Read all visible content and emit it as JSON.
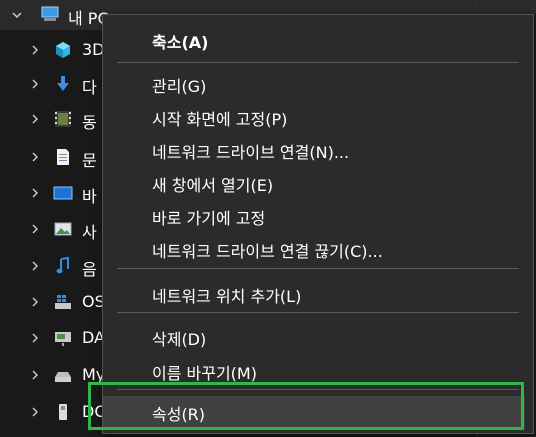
{
  "tree": {
    "root": {
      "label": "내 PC",
      "icon": "computer-icon"
    },
    "items": [
      {
        "label": "3D",
        "icon": "3d-objects-icon"
      },
      {
        "label": "다",
        "icon": "download-arrow-icon"
      },
      {
        "label": "동",
        "icon": "video-film-icon"
      },
      {
        "label": "문",
        "icon": "document-icon"
      },
      {
        "label": "바",
        "icon": "desktop-icon"
      },
      {
        "label": "사",
        "icon": "picture-icon"
      },
      {
        "label": "음",
        "icon": "music-note-icon"
      },
      {
        "label": "OS",
        "icon": "windows-drive-icon"
      },
      {
        "label": "DA",
        "icon": "network-drive-icon"
      },
      {
        "label": "My",
        "icon": "drive-icon"
      },
      {
        "label": "DC",
        "icon": "usb-drive-icon"
      }
    ]
  },
  "context_menu": {
    "items": [
      {
        "label": "축소(A)",
        "bold": true
      },
      {
        "separator": true
      },
      {
        "label": "관리(G)"
      },
      {
        "label": "시작 화면에 고정(P)"
      },
      {
        "label": "네트워크 드라이브 연결(N)..."
      },
      {
        "label": "새 창에서 열기(E)"
      },
      {
        "label": "바로 가기에 고정"
      },
      {
        "label": "네트워크 드라이브 연결 끊기(C)..."
      },
      {
        "separator": true
      },
      {
        "label": "네트워크 위치 추가(L)"
      },
      {
        "separator": true
      },
      {
        "label": "삭제(D)"
      },
      {
        "label": "이름 바꾸기(M)"
      },
      {
        "separator": true
      },
      {
        "label": "속성(R)",
        "hovered": true
      }
    ]
  },
  "colors": {
    "menu_bg": "#2b2b2b",
    "hover_bg": "#414141",
    "highlight_border": "#2fb84a",
    "window_bg": "#191919"
  }
}
